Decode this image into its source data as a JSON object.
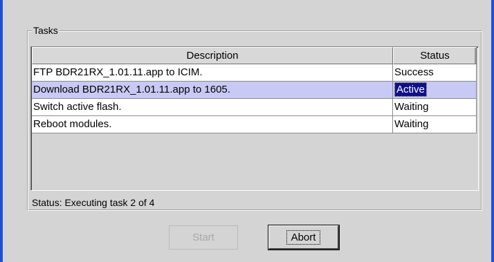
{
  "group": {
    "title": "Tasks"
  },
  "table": {
    "columns": [
      "Description",
      "Status"
    ],
    "rows": [
      {
        "description": "FTP BDR21RX_1.01.11.app to ICIM.",
        "status": "Success"
      },
      {
        "description": "Download BDR21RX_1.01.11.app to 1605.",
        "status": "Active"
      },
      {
        "description": "Switch active flash.",
        "status": "Waiting"
      },
      {
        "description": "Reboot modules.",
        "status": "Waiting"
      }
    ],
    "selected_row": 1
  },
  "status_line": "Status: Executing task 2 of 4",
  "buttons": {
    "start_label": "Start",
    "abort_label": "Abort"
  },
  "colors": {
    "window_border": "#1f4fd6",
    "selected_row": "#c9c9f5",
    "active_badge": "#10108c"
  }
}
